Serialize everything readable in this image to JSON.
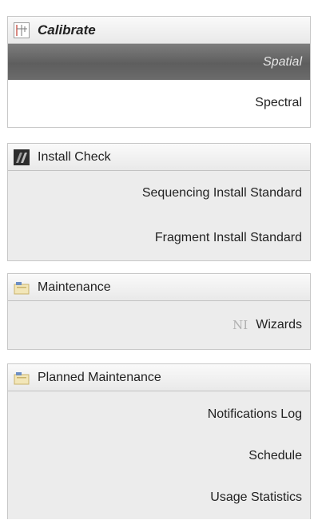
{
  "calibrate": {
    "title": "Calibrate",
    "items": [
      "Spatial",
      "Spectral"
    ]
  },
  "install_check": {
    "title": "Install Check",
    "items": [
      "Sequencing Install Standard",
      "Fragment Install Standard"
    ]
  },
  "maintenance": {
    "title": "Maintenance",
    "items": [
      "Wizards"
    ],
    "wizards_icon_glyph": "ΝΙ"
  },
  "planned_maintenance": {
    "title": "Planned Maintenance",
    "items": [
      "Notifications Log",
      "Schedule",
      "Usage Statistics"
    ]
  },
  "colors": {
    "selected_bg": "#6b6b6b",
    "panel_bg": "#ececec"
  }
}
